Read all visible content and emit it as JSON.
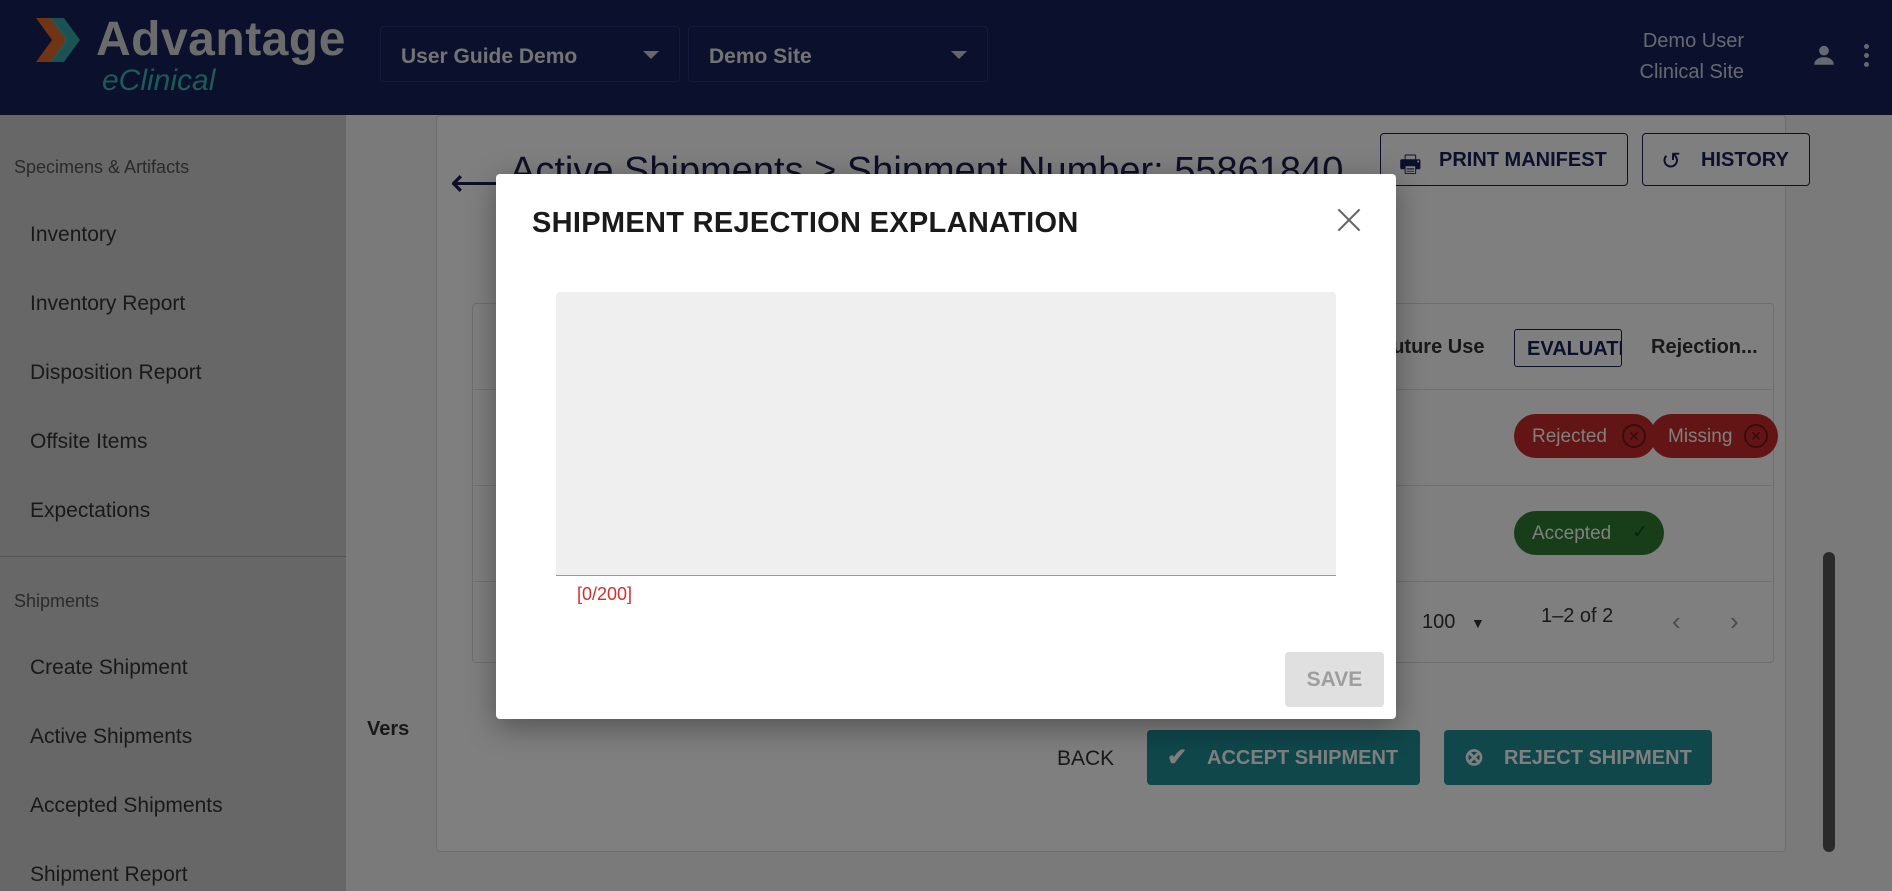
{
  "header": {
    "logo_text": "Advantage",
    "logo_sub": "eClinical",
    "study_select": "User Guide Demo",
    "site_select": "Demo Site",
    "user_name": "Demo User",
    "user_role": "Clinical Site"
  },
  "sidebar": {
    "section_specimens": "Specimens & Artifacts",
    "items_specimens": [
      "Inventory",
      "Inventory Report",
      "Disposition Report",
      "Offsite Items",
      "Expectations"
    ],
    "section_shipments": "Shipments",
    "items_shipments": [
      "Create Shipment",
      "Active Shipments",
      "Accepted Shipments",
      "Shipment Report"
    ]
  },
  "main": {
    "breadcrumb_parent": "Active Shipments",
    "breadcrumb_sep": ">",
    "breadcrumb_current": "Shipment Number: 55861840",
    "print_manifest": "PRINT MANIFEST",
    "history": "HISTORY",
    "col_future_use": "Future Use",
    "col_evaluation": "EVALUATI",
    "col_rejection": "Rejection...",
    "row1_status": [
      "Rejected",
      "Missing"
    ],
    "row2_status": "Accepted",
    "page_size": "100",
    "pagination": "1–2 of 2",
    "back": "BACK",
    "accept_shipment": "ACCEPT SHIPMENT",
    "reject_shipment": "REJECT SHIPMENT",
    "version_label": "Vers"
  },
  "dialog": {
    "title": "SHIPMENT REJECTION EXPLANATION",
    "textarea_value": "",
    "counter": "[0/200]",
    "save": "SAVE"
  },
  "colors": {
    "header_bg": "#16205a",
    "accent_teal": "#1f8f97",
    "rejected": "#c62828",
    "accepted": "#2e7d32",
    "error_text": "#d32f2f"
  }
}
